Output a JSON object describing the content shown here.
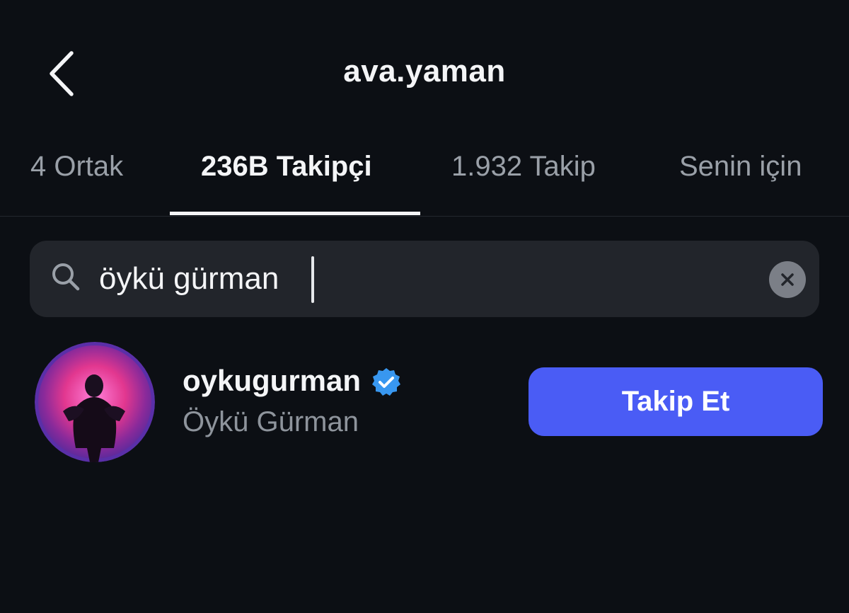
{
  "header": {
    "title": "ava.yaman",
    "back_icon": "chevron-left-icon"
  },
  "tabs": [
    {
      "label": "4 Ortak",
      "active": false
    },
    {
      "label": "236B Takipçi",
      "active": true
    },
    {
      "label": "1.932 Takip",
      "active": false
    },
    {
      "label": "Senin için",
      "active": false
    }
  ],
  "search": {
    "value": "öykü gürman",
    "placeholder": "",
    "icon": "search-icon",
    "clear_icon": "clear-icon"
  },
  "results": [
    {
      "username": "oykugurman",
      "verified": true,
      "full_name": "Öykü Gürman",
      "action_label": "Takip Et"
    }
  ],
  "colors": {
    "background": "#0c0f14",
    "search_bg": "#22252b",
    "accent": "#4a5cf5",
    "verified_badge": "#3897f0",
    "muted_text": "#8e949c"
  }
}
